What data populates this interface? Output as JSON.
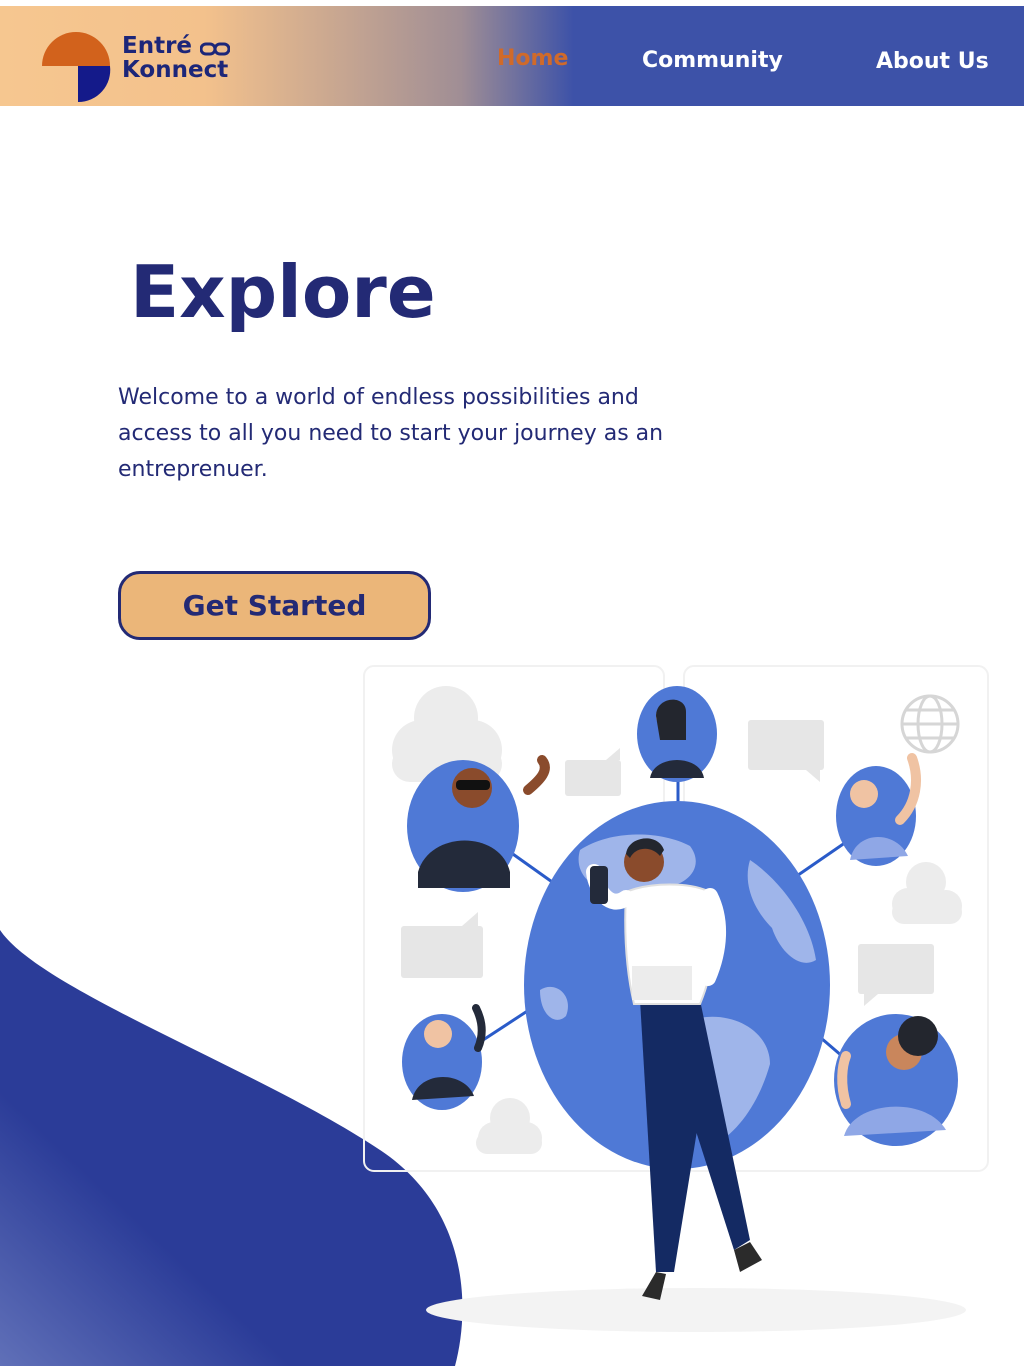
{
  "brand": {
    "line1": "Entré",
    "line2": "Konnect"
  },
  "nav": {
    "home": "Home",
    "community": "Community",
    "about": "About Us"
  },
  "hero": {
    "title": "Explore",
    "subtitle": "Welcome to a world of endless possibilities and access to all you need to start your journey as an entreprenuer.",
    "cta_label": "Get Started"
  },
  "colors": {
    "navy": "#232a75",
    "accent_orange": "#d06a2a",
    "button_fill": "#ebb679",
    "globe_blue": "#4f79d6",
    "blob_blue": "#2b3c98"
  },
  "icons": [
    "logo-mark-icon",
    "chain-link-icon",
    "globe-icon",
    "chat-bubble-icon",
    "cloud-icon"
  ]
}
